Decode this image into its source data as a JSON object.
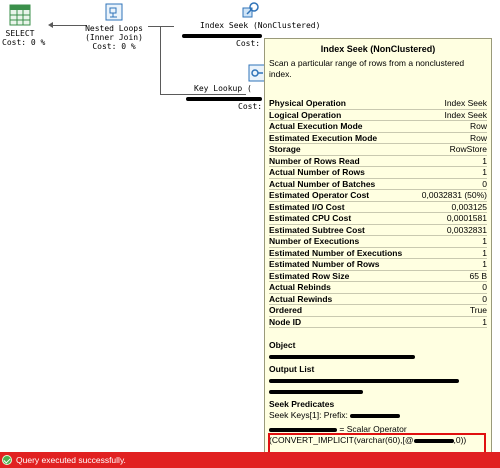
{
  "plan": {
    "select_node": {
      "label": "SELECT",
      "cost": "Cost: 0 %"
    },
    "nested_loops_node": {
      "label": "Nested Loops",
      "join_type": "(Inner Join)",
      "cost": "Cost: 0 %"
    },
    "index_seek_node": {
      "label": "Index Seek (NonClustered)",
      "cost": "Cost:"
    },
    "key_lookup_node": {
      "label": "Key Lookup (",
      "cost": "Cost:"
    }
  },
  "tooltip": {
    "title": "Index Seek (NonClustered)",
    "description": "Scan a particular range of rows from a nonclustered index.",
    "properties": [
      {
        "key": "Physical Operation",
        "value": "Index Seek"
      },
      {
        "key": "Logical Operation",
        "value": "Index Seek"
      },
      {
        "key": "Actual Execution Mode",
        "value": "Row"
      },
      {
        "key": "Estimated Execution Mode",
        "value": "Row"
      },
      {
        "key": "Storage",
        "value": "RowStore"
      },
      {
        "key": "Number of Rows Read",
        "value": "1"
      },
      {
        "key": "Actual Number of Rows",
        "value": "1"
      },
      {
        "key": "Actual Number of Batches",
        "value": "0"
      },
      {
        "key": "Estimated Operator Cost",
        "value": "0,0032831 (50%)"
      },
      {
        "key": "Estimated I/O Cost",
        "value": "0,003125"
      },
      {
        "key": "Estimated CPU Cost",
        "value": "0,0001581"
      },
      {
        "key": "Estimated Subtree Cost",
        "value": "0,0032831"
      },
      {
        "key": "Number of Executions",
        "value": "1"
      },
      {
        "key": "Estimated Number of Executions",
        "value": "1"
      },
      {
        "key": "Estimated Number of Rows",
        "value": "1"
      },
      {
        "key": "Estimated Row Size",
        "value": "65 B"
      },
      {
        "key": "Actual Rebinds",
        "value": "0"
      },
      {
        "key": "Actual Rewinds",
        "value": "0"
      },
      {
        "key": "Ordered",
        "value": "True"
      },
      {
        "key": "Node ID",
        "value": "1"
      }
    ],
    "object_heading": "Object",
    "output_list_heading": "Output List",
    "seek_predicates_heading": "Seek Predicates",
    "seek_keys_prefix": "Seek Keys[1]: Prefix:",
    "seek_scalar_operator": "= Scalar Operator",
    "seek_convert_start": "(CONVERT_IMPLICIT(varchar(60),[@",
    "seek_convert_end": ",0))"
  },
  "status": {
    "message": "Query executed successfully."
  },
  "colors": {
    "status_bar": "#e12121",
    "tooltip_bg": "#ffffe1",
    "highlight_box": "#e01010"
  }
}
